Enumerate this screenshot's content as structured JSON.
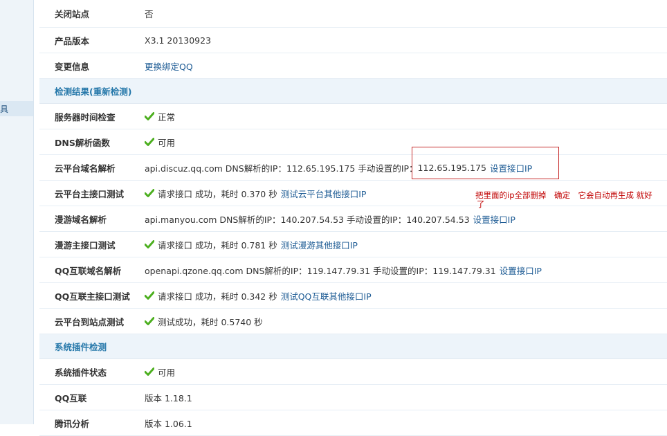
{
  "sidebar": {
    "selected_fragment": "具"
  },
  "rows_top": [
    {
      "label": "关闭站点",
      "value": "否"
    },
    {
      "label": "产品版本",
      "value": "X3.1 20130923"
    },
    {
      "label": "变更信息",
      "link": "更换绑定QQ"
    }
  ],
  "section_check": "检测结果(重新检测)",
  "check_rows": {
    "server_time": {
      "label": "服务器时间检查",
      "status": "正常"
    },
    "dns_func": {
      "label": "DNS解析函数",
      "status": "可用"
    },
    "cloud_domain": {
      "label": "云平台域名解析",
      "text": "api.discuz.qq.com DNS解析的IP：112.65.195.175 手动设置的IP：",
      "manual_ip": "112.65.195.175",
      "link": "设置接口IP"
    },
    "cloud_api": {
      "label": "云平台主接口测试",
      "status": "请求接口 成功，耗时 0.370 秒",
      "link": "测试云平台其他接口IP"
    },
    "manyou_domain": {
      "label": "漫游域名解析",
      "text": "api.manyou.com DNS解析的IP：140.207.54.53 手动设置的IP：140.207.54.53",
      "link": "设置接口IP"
    },
    "manyou_api": {
      "label": "漫游主接口测试",
      "status": "请求接口 成功，耗时 0.781 秒",
      "link": "测试漫游其他接口IP"
    },
    "qq_domain": {
      "label": "QQ互联域名解析",
      "text": "openapi.qzone.qq.com DNS解析的IP：119.147.79.31 手动设置的IP：119.147.79.31",
      "link": "设置接口IP"
    },
    "qq_api": {
      "label": "QQ互联主接口测试",
      "status": "请求接口 成功，耗时 0.342 秒",
      "link": "测试QQ互联其他接口IP"
    },
    "cloud_site": {
      "label": "云平台到站点测试",
      "status": "测试成功，耗时 0.5740 秒"
    }
  },
  "section_plugins": "系统插件检测",
  "plugin_rows": {
    "plugin_status": {
      "label": "系统插件状态",
      "status": "可用"
    },
    "qq_connect": {
      "label": "QQ互联",
      "value": "版本 1.18.1"
    },
    "tencent_analysis": {
      "label": "腾讯分析",
      "value": "版本 1.06.1"
    }
  },
  "annotation": {
    "line1": "把里面的ip全部删掉　确定　它会自动再生成 就好",
    "line2": "了"
  },
  "colors": {
    "section_bg": "#edf4fa",
    "section_text": "#2678aa",
    "link": "#1d5b94",
    "check": "#4caf1f",
    "annotation": "#c00000"
  }
}
